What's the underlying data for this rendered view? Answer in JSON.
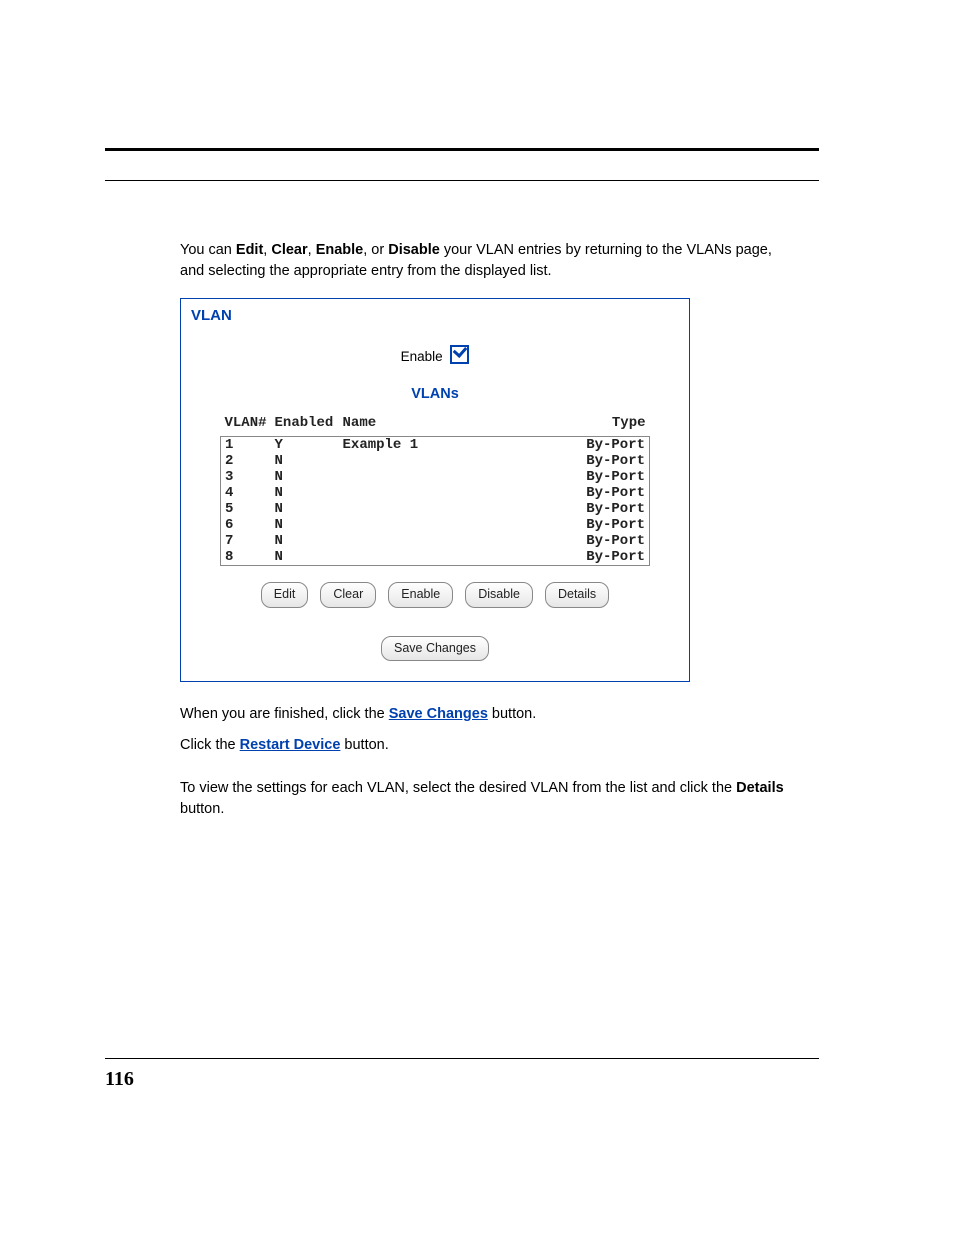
{
  "intro": {
    "prefix": "You can ",
    "b1": "Edit",
    "sep1": ", ",
    "b2": "Clear",
    "sep2": ", ",
    "b3": "Enable",
    "sep3": ", or ",
    "b4": "Disable",
    "rest": " your VLAN entries by returning to the VLANs page, and selecting the appropriate entry from the displayed list."
  },
  "panel": {
    "title": "VLAN",
    "enable_label": "Enable",
    "vlans_heading": "VLANs",
    "headers": {
      "num": "VLAN#",
      "enabled": "Enabled",
      "name": "Name",
      "type": "Type"
    },
    "rows": [
      {
        "num": "1",
        "enabled": "Y",
        "name": "Example 1",
        "type": "By-Port"
      },
      {
        "num": "2",
        "enabled": "N",
        "name": "",
        "type": "By-Port"
      },
      {
        "num": "3",
        "enabled": "N",
        "name": "",
        "type": "By-Port"
      },
      {
        "num": "4",
        "enabled": "N",
        "name": "",
        "type": "By-Port"
      },
      {
        "num": "5",
        "enabled": "N",
        "name": "",
        "type": "By-Port"
      },
      {
        "num": "6",
        "enabled": "N",
        "name": "",
        "type": "By-Port"
      },
      {
        "num": "7",
        "enabled": "N",
        "name": "",
        "type": "By-Port"
      },
      {
        "num": "8",
        "enabled": "N",
        "name": "",
        "type": "By-Port"
      }
    ],
    "buttons": {
      "edit": "Edit",
      "clear": "Clear",
      "enable": "Enable",
      "disable": "Disable",
      "details": "Details",
      "save": "Save Changes"
    }
  },
  "post1": {
    "prefix": "When you are finished, click the ",
    "link": "Save Changes",
    "suffix": " button."
  },
  "post2": {
    "prefix": "Click the ",
    "link": "Restart Device",
    "suffix": " button."
  },
  "details": {
    "line": "To view the settings for each VLAN, select the desired VLAN from the list and click the ",
    "bold": "Details",
    "suffix": " button."
  },
  "page_number": "116"
}
